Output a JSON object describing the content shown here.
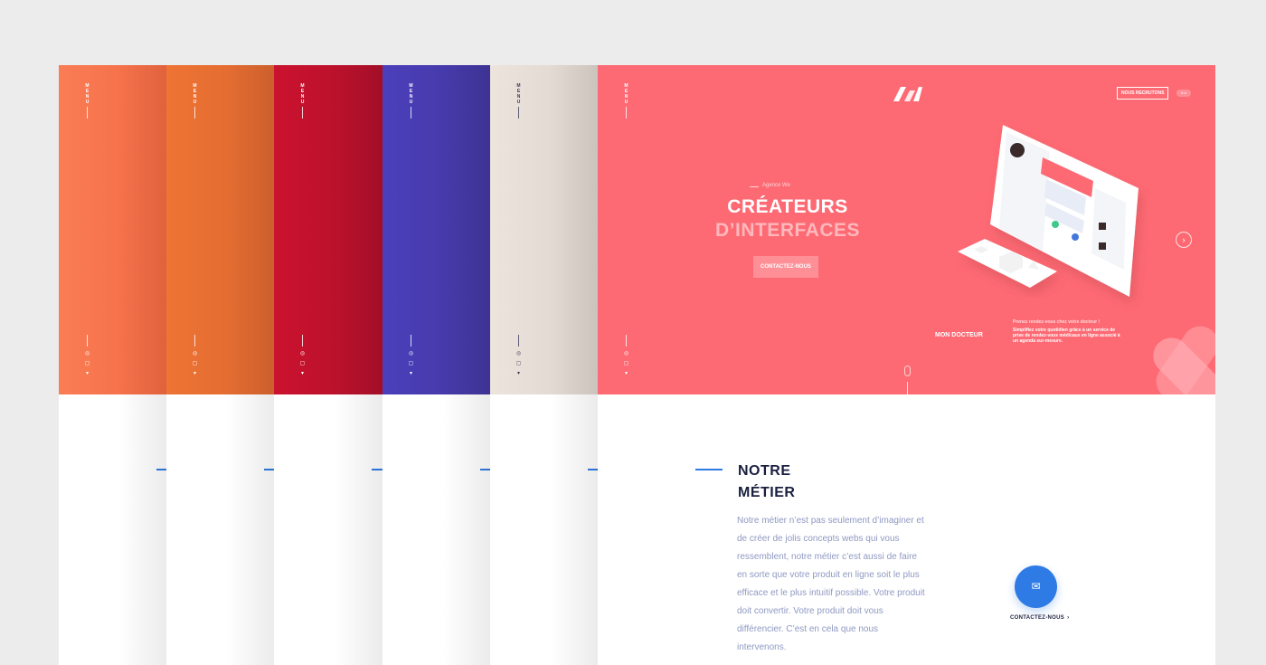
{
  "panels": [
    {
      "menu_label": "MENU",
      "color": "#fa7d55",
      "color2": "#f26a43",
      "text": "#ffffff"
    },
    {
      "menu_label": "MENU",
      "color": "#ee7434",
      "color2": "#dd6730",
      "text": "#ffffff"
    },
    {
      "menu_label": "MENU",
      "color": "#cb122e",
      "color2": "#b0102b",
      "text": "#ffffff"
    },
    {
      "menu_label": "MENU",
      "color": "#4c3fbc",
      "color2": "#42379e",
      "text": "#ffffff"
    },
    {
      "menu_label": "MENU",
      "color": "#ede4dd",
      "color2": "#dcd3cc",
      "text": "#3a3a5a"
    },
    {
      "menu_label": "MENU",
      "color": "#fe6a74",
      "color2": "#fe6a74",
      "text": "#ffffff"
    }
  ],
  "social_icons": [
    "dribbble-icon",
    "instagram-icon",
    "twitter-icon"
  ],
  "header": {
    "recruit_label": "NOUS RECRUTONS",
    "lang_label": "fr-e"
  },
  "hero": {
    "eyebrow": "Agence We",
    "title_line1": "CRÉATEURS",
    "title_line2": "D’INTERFACES",
    "cta_label": "CONTACTEZ-NOUS",
    "next_icon": "›",
    "project_name": "MON DOCTEUR",
    "project_tag": "Prenez rendez-vous chez votre docteur !",
    "project_desc": "Simplifiez votre quotidien grâce à un service de prise de rendez-vous médicaux en ligne associé à un agenda sur-mesure."
  },
  "section": {
    "title_line1": "NOTRE",
    "title_line2": "MÉTIER",
    "body": "Notre métier n’est pas seulement d’imaginer et de créer de jolis concepts webs qui vous ressemblent, notre métier c’est aussi de faire en sorte que votre produit en ligne soit le plus efficace et le plus intuitif possible. Votre produit doit convertir. Votre produit doit vous différencier. C’est en cela que nous intervenons.",
    "contact_label": "CONTACTEZ-NOUS",
    "contact_chevron": "›"
  },
  "colors": {
    "accent": "#2f7be6",
    "hero_bg": "#fe6a74",
    "heading": "#1b2040",
    "body_text": "#8f99c2"
  }
}
